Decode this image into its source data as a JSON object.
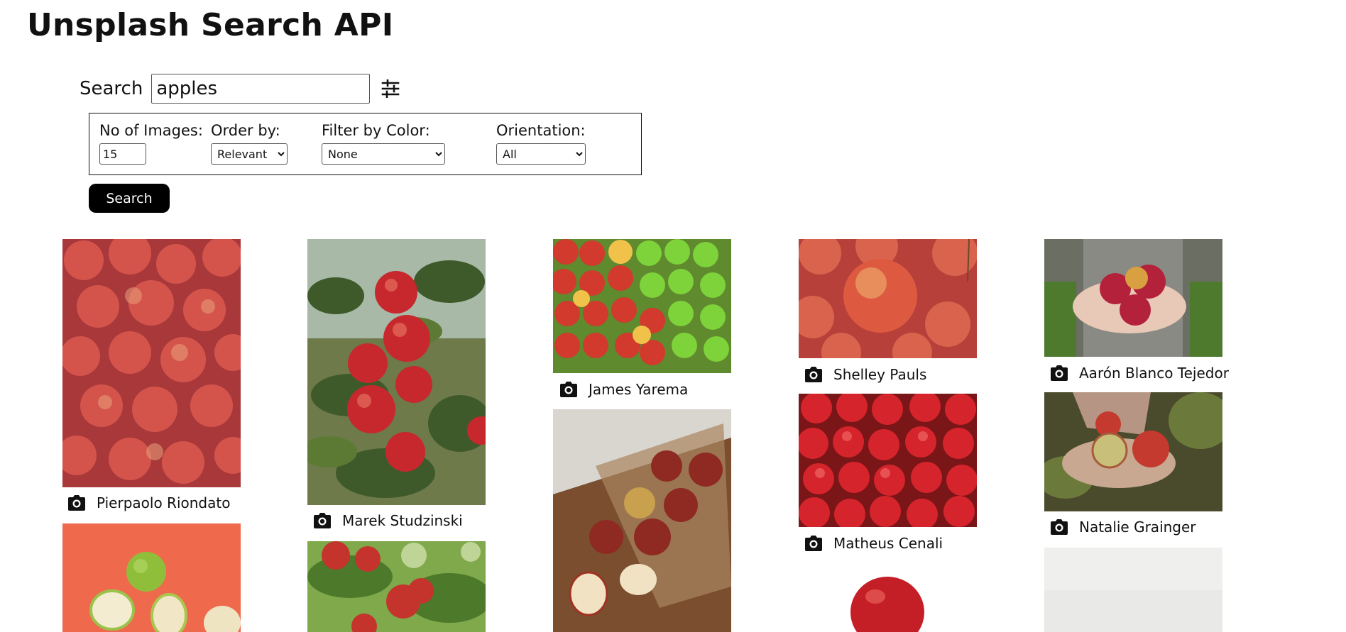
{
  "header": {
    "title": "Unsplash Search API"
  },
  "search": {
    "label": "Search",
    "value": "apples"
  },
  "options": {
    "count_label": "No of Images:",
    "count_value": "15",
    "order_label": "Order by:",
    "order_value": "Relevant",
    "color_label": "Filter by Color:",
    "color_value": "None",
    "orientation_label": "Orientation:",
    "orientation_value": "All"
  },
  "search_button": {
    "label": "Search"
  },
  "results": [
    {
      "photographer": "Pierpaolo Riondato"
    },
    {
      "photographer": "Marek Studzinski"
    },
    {
      "photographer": "James Yarema"
    },
    {
      "photographer": "Shelley Pauls"
    },
    {
      "photographer": "Aarón Blanco Tejedor"
    },
    {
      "photographer": "Matheus Cenali"
    },
    {
      "photographer": "Natalie Grainger"
    }
  ],
  "icons": {
    "filter": "sliders-icon",
    "credit": "camera-icon"
  },
  "colors": {
    "button_bg": "#000000",
    "button_text": "#ffffff",
    "apple_red": "#c8242a"
  }
}
